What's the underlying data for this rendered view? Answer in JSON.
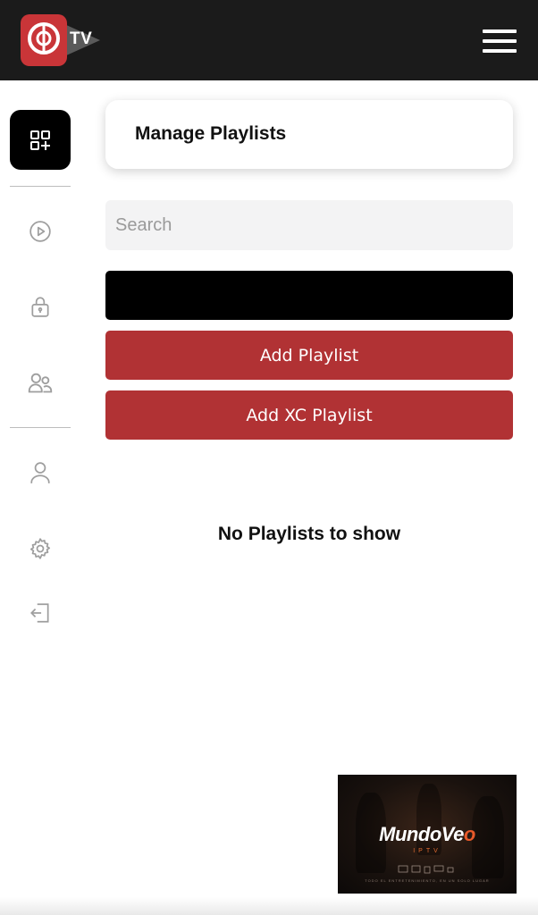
{
  "header": {
    "logo_text": "TV",
    "logo_icon": "app-logo-icon",
    "menu_icon": "hamburger-menu-icon"
  },
  "sidebar": {
    "items": [
      {
        "name": "manage-playlists",
        "icon": "grid-add-icon",
        "active": true
      },
      {
        "name": "player",
        "icon": "play-circle-icon",
        "active": false
      },
      {
        "name": "parental-lock",
        "icon": "lock-icon",
        "active": false
      },
      {
        "name": "users",
        "icon": "users-icon",
        "active": false
      },
      {
        "name": "account",
        "icon": "user-icon",
        "active": false
      },
      {
        "name": "settings",
        "icon": "gear-icon",
        "active": false
      },
      {
        "name": "logout",
        "icon": "logout-icon",
        "active": false
      }
    ]
  },
  "main": {
    "title": "Manage Playlists",
    "search_placeholder": "Search",
    "add_playlist_label": "Add Playlist",
    "add_xc_playlist_label": "Add XC Playlist",
    "empty_message": "No Playlists to show"
  },
  "ad": {
    "brand_main": "MundoVe",
    "brand_accent": "o",
    "subtitle": "IPTV",
    "tagline": "TODO EL ENTRETENIMIENTO, EN UN SOLO LUGAR"
  },
  "colors": {
    "topbar": "#1b1b1b",
    "brand_red": "#b13234",
    "active_tile": "#000000",
    "icon_gray": "#9e9e9e"
  }
}
